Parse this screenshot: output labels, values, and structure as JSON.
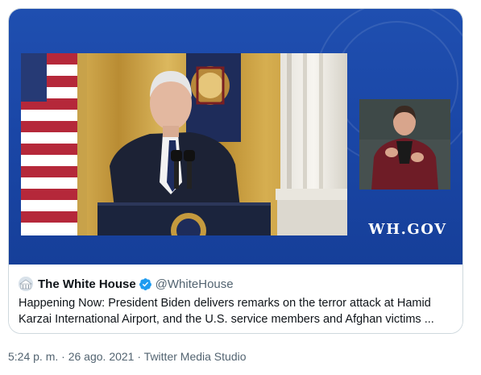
{
  "media": {
    "logo_text": "WH.GOV"
  },
  "account": {
    "name": "The White House",
    "handle": "@WhiteHouse"
  },
  "tweet": {
    "text": "Happening Now: President Biden delivers remarks on the terror attack at Hamid Karzai International Airport, and the U.S. service members and Afghan victims ..."
  },
  "meta": {
    "time": "5:24 p. m.",
    "separator": " · ",
    "date": "26 ago. 2021",
    "source": "Twitter Media Studio"
  },
  "colors": {
    "media_blue": "#1a46a6",
    "verified_blue": "#1d9bf0",
    "secondary_text": "#536471"
  },
  "icons": [
    "verified-badge-icon",
    "white-house-avatar"
  ]
}
